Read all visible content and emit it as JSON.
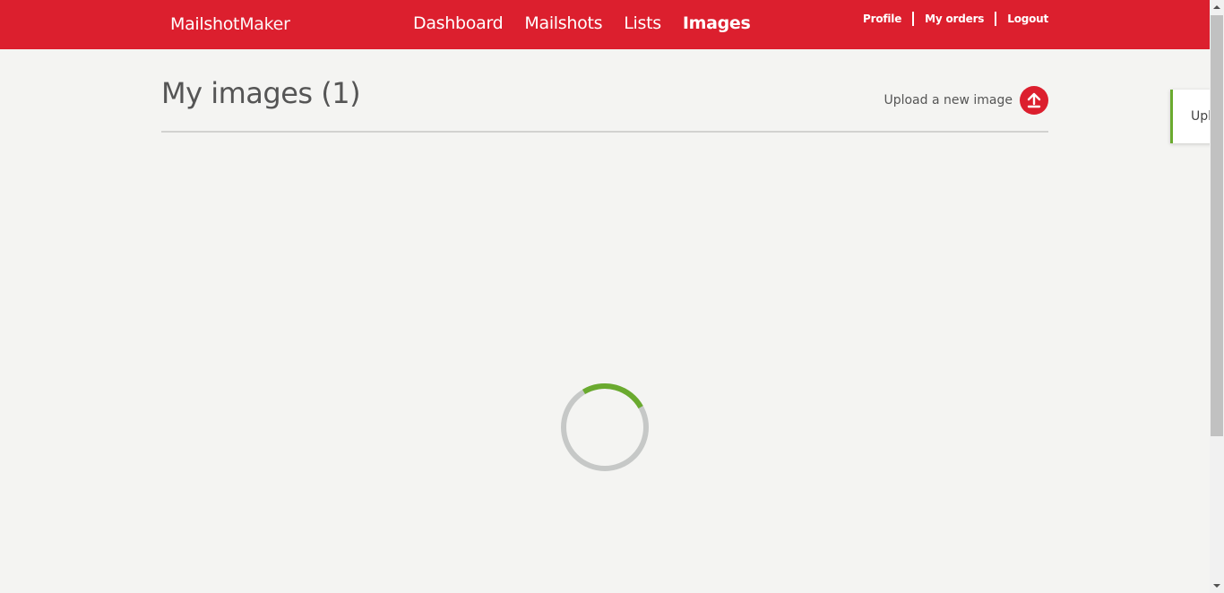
{
  "header": {
    "brand_part1": "Mailshot",
    "brand_part2": "Maker",
    "nav": {
      "dashboard": "Dashboard",
      "mailshots": "Mailshots",
      "lists": "Lists",
      "images": "Images"
    },
    "active_nav": "Images",
    "user_nav": {
      "profile": "Profile",
      "orders": "My orders",
      "logout": "Logout"
    }
  },
  "main": {
    "title": "My images (1)",
    "upload_label": "Upload a new image",
    "upload_icon": "upload-arrow-icon"
  },
  "toast": {
    "text": "Upl"
  },
  "colors": {
    "brand_red": "#dc1f2e",
    "spinner_green": "#6aaa2f",
    "spinner_track": "#c6c8c7",
    "background": "#f4f4f2"
  }
}
